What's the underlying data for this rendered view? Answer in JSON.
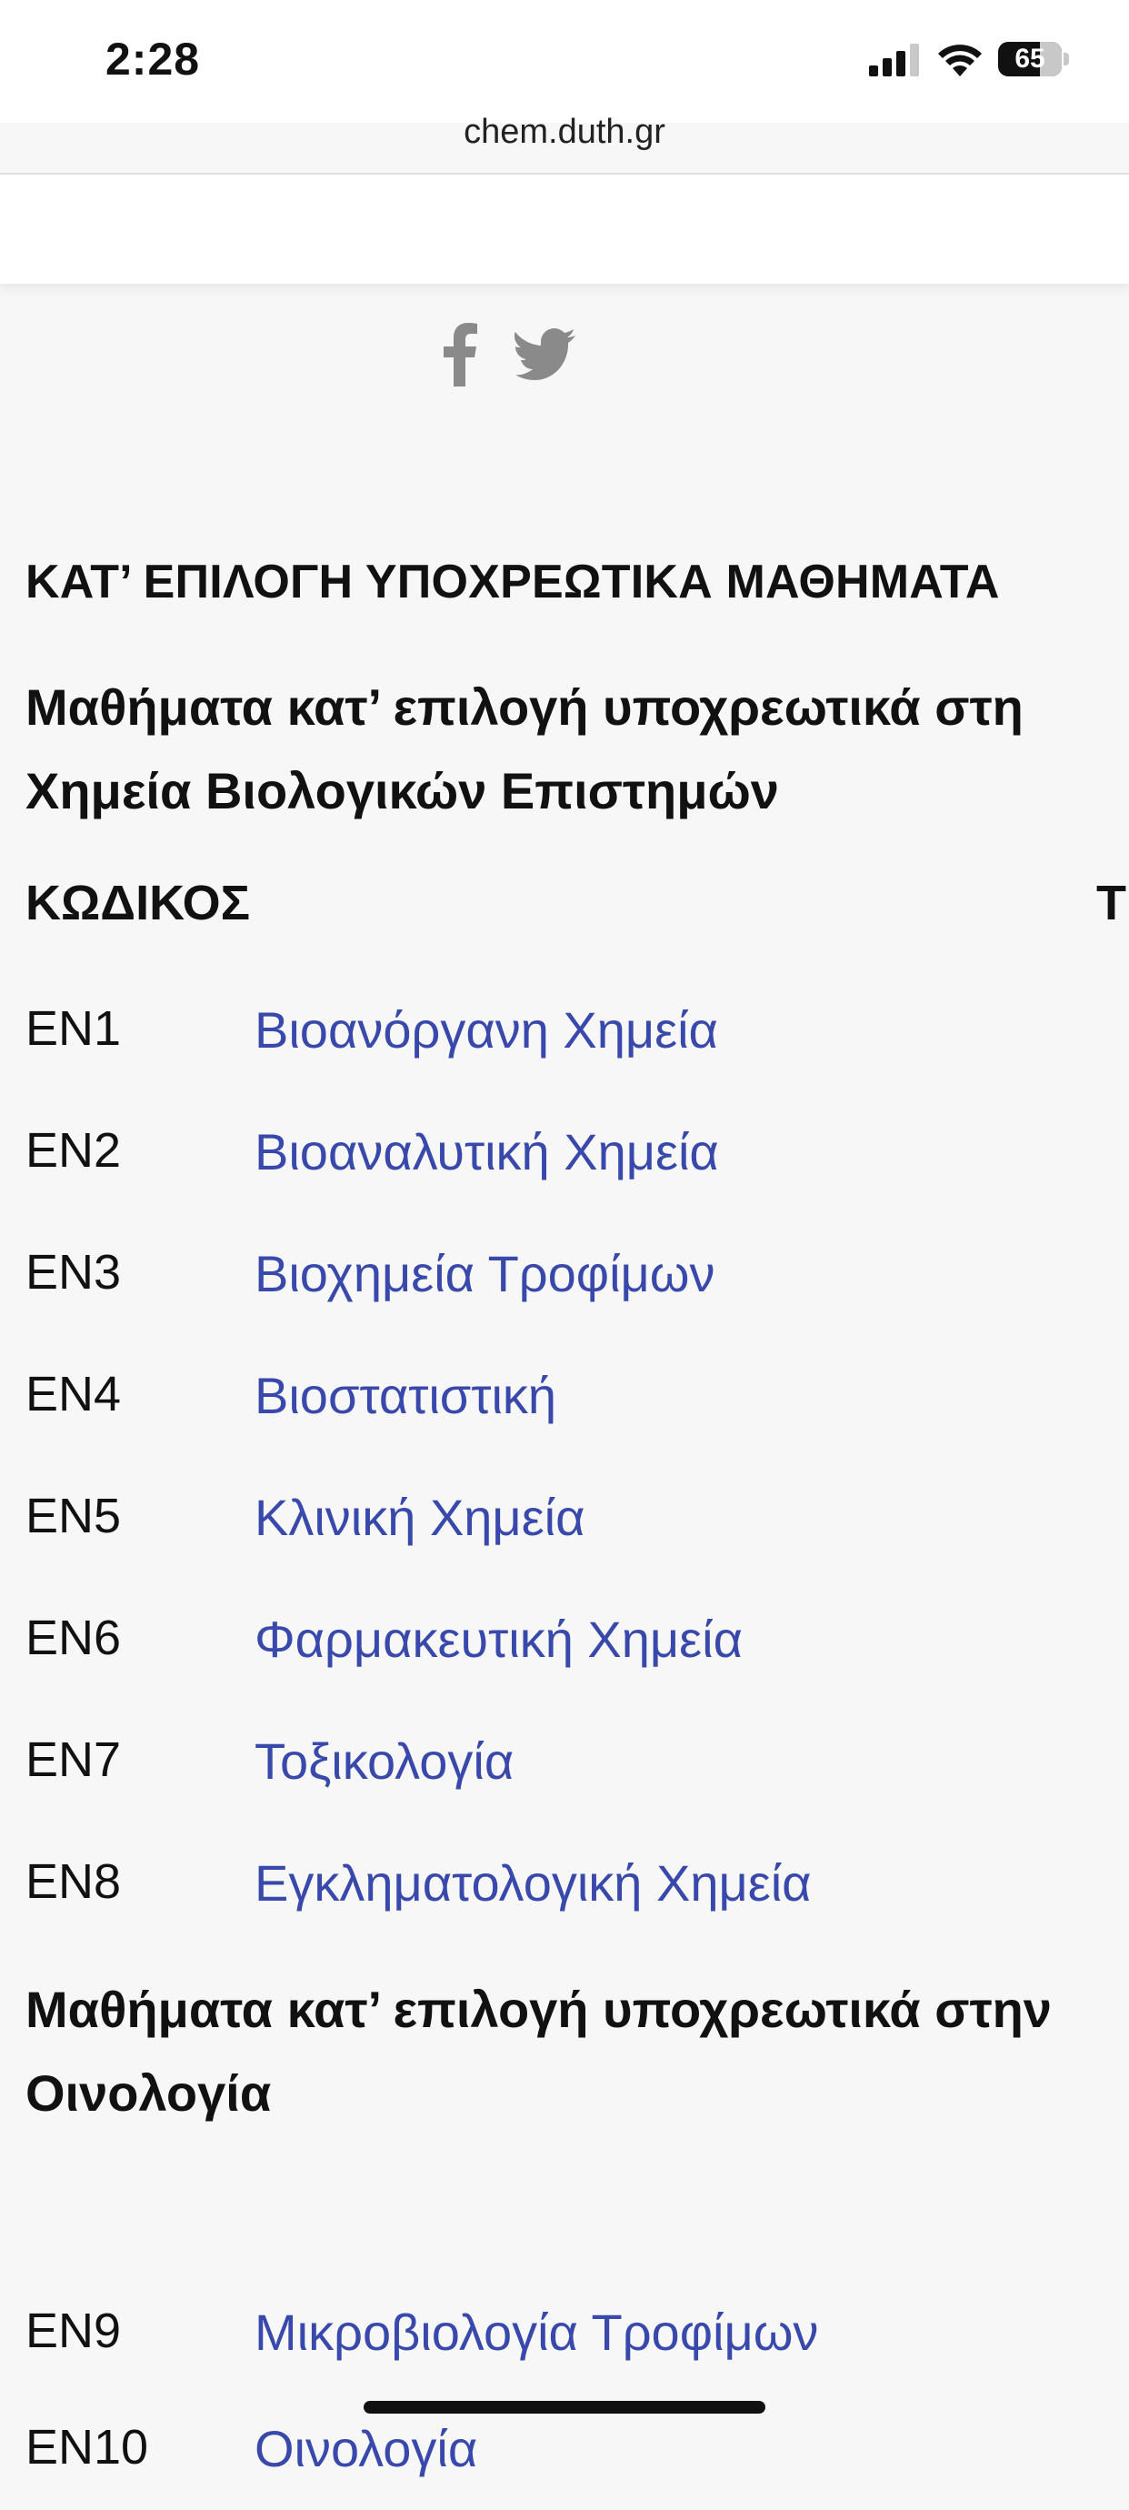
{
  "status": {
    "time": "2:28",
    "battery": "65"
  },
  "browser": {
    "url": "chem.duth.gr"
  },
  "social": {
    "facebook_icon": "facebook-icon",
    "twitter_icon": "twitter-icon",
    "color": "#8a8a8a"
  },
  "page": {
    "section_title": "ΚΑΤ’ ΕΠΙΛΟΓΗ ΥΠΟΧΡΕΩΤΙΚΑ ΜΑΘΗΜΑΤΑ",
    "group1_title": "Μαθήματα κατ’ επιλογή υποχρεωτικά στη Χημεία Βιολογικών Επιστημών",
    "col_code": "ΚΩΔΙΚΟΣ",
    "col_second": "Τ",
    "courses1": [
      {
        "code": "EN1",
        "title": "Βιοανόργανη Χημεία"
      },
      {
        "code": "EN2",
        "title": "Βιοαναλυτική Χημεία"
      },
      {
        "code": "EN3",
        "title": "Βιοχημεία Τροφίμων"
      },
      {
        "code": "EN4",
        "title": "Βιοστατιστική"
      },
      {
        "code": "EN5",
        "title": "Κλινική Χημεία"
      },
      {
        "code": "EN6",
        "title": "Φαρμακευτική Χημεία"
      },
      {
        "code": "EN7",
        "title": "Τοξικολογία"
      },
      {
        "code": "EN8",
        "title": "Εγκληματολογική Χημεία"
      }
    ],
    "group2_title": "Μαθήματα κατ’ επιλογή υποχρεωτικά στην Οινολογία",
    "courses2": [
      {
        "code": "EN9",
        "title": "Μικροβιολογία Τροφίμων"
      },
      {
        "code": "EN10",
        "title": "Οινολογία"
      }
    ],
    "link_color": "#3949ab"
  }
}
